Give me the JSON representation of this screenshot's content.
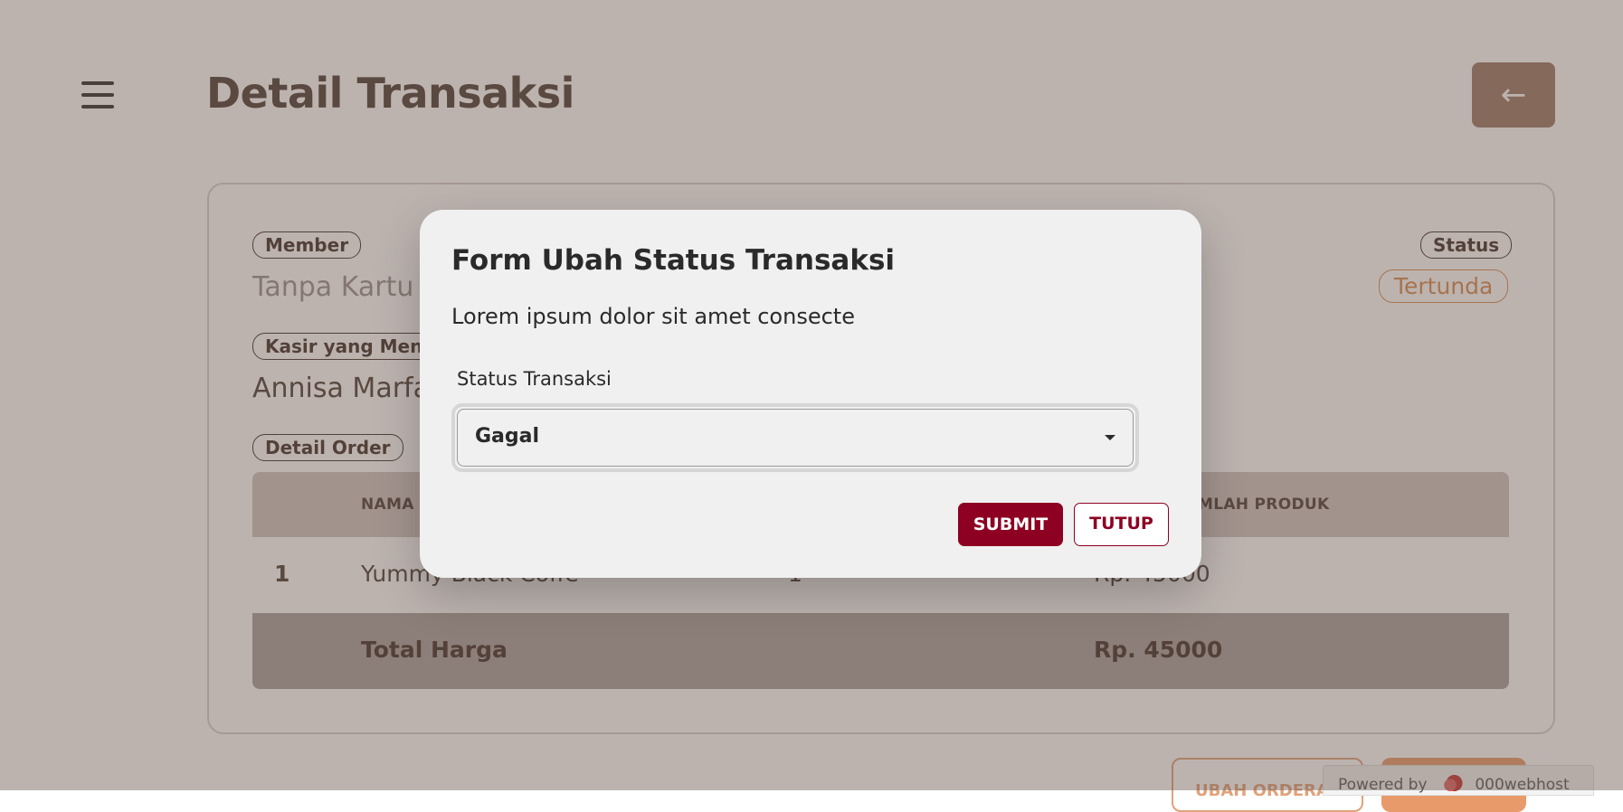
{
  "header": {
    "title": "Detail Transaksi",
    "menu_icon": "hamburger-menu-icon",
    "back_icon": "arrow-left-icon",
    "back_glyph": "←"
  },
  "detail": {
    "member_label": "Member",
    "member_value": "Tanpa Kartu",
    "cashier_label": "Kasir yang Meng",
    "cashier_value": "Annisa Marfa",
    "status_label": "Status",
    "status_value": "Tertunda",
    "order_label": "Detail Order"
  },
  "table": {
    "col_name": "NAMA P",
    "col_total": "MLAH PRODUK",
    "rows": [
      {
        "no": "1",
        "name": "Yummy Black Coffe",
        "qty": "1",
        "total": "Rp. 45000"
      }
    ],
    "total_label": "Total Harga",
    "total_value": "Rp. 45000"
  },
  "actions": {
    "change_order_label": "UBAH ORDERA"
  },
  "watermark": {
    "powered_by": "Powered by",
    "brand": "000webhost"
  },
  "modal": {
    "title": "Form Ubah Status Transaksi",
    "description": "Lorem ipsum dolor sit amet consecte",
    "select_label": "Status Transaksi",
    "select_value": "Gagal",
    "submit_label": "SUBMIT",
    "close_label": "TUTUP"
  },
  "colors": {
    "primary": "#8e0022",
    "accent": "#d88a4a",
    "back_button": "#9a7664"
  }
}
